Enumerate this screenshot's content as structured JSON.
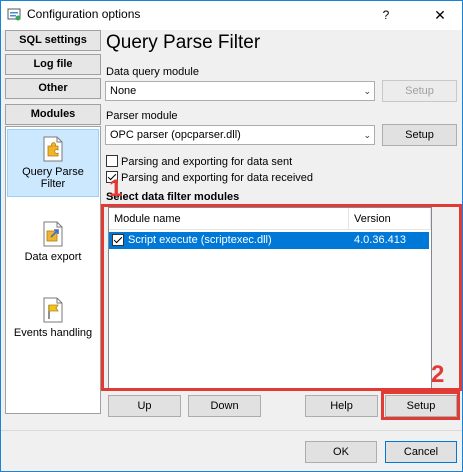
{
  "window": {
    "title": "Configuration options",
    "help_label": "?",
    "close_label": "✕"
  },
  "sidebar": {
    "tabs": [
      "SQL settings",
      "Log file",
      "Other",
      "Modules"
    ],
    "nav": [
      {
        "label_line1": "Query Parse",
        "label_line2": "Filter",
        "icon": "puzzle-icon",
        "active": true
      },
      {
        "label_line1": "Data export",
        "label_line2": "",
        "icon": "export-icon",
        "active": false
      },
      {
        "label_line1": "Events handling",
        "label_line2": "",
        "icon": "flag-icon",
        "active": false
      }
    ]
  },
  "main": {
    "title": "Query Parse Filter",
    "data_query_module_label": "Data query module",
    "data_query_module_value": "None",
    "data_query_setup": "Setup",
    "parser_module_label": "Parser module",
    "parser_module_value": "OPC parser (opcparser.dll)",
    "parser_setup": "Setup",
    "chk_sent_label": "Parsing and exporting for data sent",
    "chk_sent_checked": false,
    "chk_received_label": "Parsing and exporting for data received",
    "chk_received_checked": true,
    "filters_heading": "Select data filter modules",
    "list": {
      "columns": [
        "Module name",
        "Version"
      ],
      "rows": [
        {
          "name": "Script execute (scriptexec.dll)",
          "version": "4.0.36.413",
          "checked": true
        }
      ]
    },
    "buttons": {
      "up": "Up",
      "down": "Down",
      "help": "Help",
      "setup": "Setup"
    }
  },
  "annotations": {
    "one": "1",
    "two": "2",
    "color": "#e23a34"
  },
  "footer": {
    "ok": "OK",
    "cancel": "Cancel"
  }
}
